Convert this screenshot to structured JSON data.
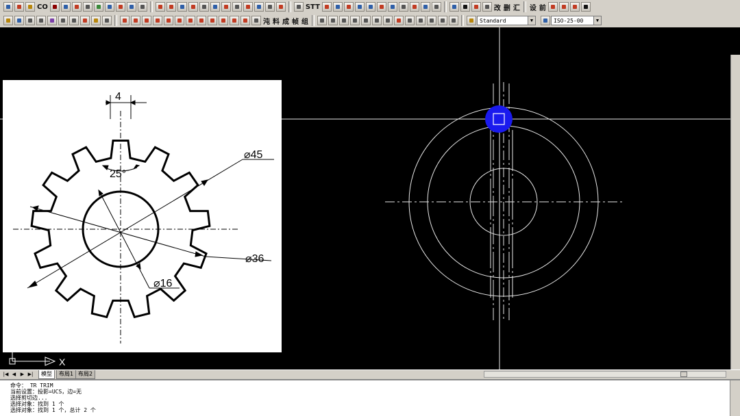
{
  "toolbar": {
    "standard_text_icons": [
      "CO",
      "STT"
    ],
    "chinese_row1": [
      "改",
      "删",
      "汇",
      "设",
      "前"
    ],
    "chinese_row2": [
      "沌",
      "料",
      "成",
      "帧",
      "组"
    ],
    "text_style": "Standard",
    "dim_style": "ISO-25-00"
  },
  "gear_drawing": {
    "dim_tooth_width": "4",
    "dim_tooth_angle": "25°",
    "dim_outer_diameter": "⌀45",
    "dim_root_diameter": "⌀36",
    "dim_bore_diameter": "⌀16"
  },
  "ucs": {
    "x_label": "X"
  },
  "layout_tabs": [
    "模型",
    "布局1",
    "布局2"
  ],
  "command_lines": [
    "命令： TR TRIM",
    "当前设置：投影=UCS，边=无",
    "选择剪切边...",
    "选择对象：找到 1 个",
    "选择对象：找到 1 个，总计 2 个"
  ],
  "colors": {
    "canvas": "#000000",
    "geometry": "#ffffff",
    "grip_highlight": "#1a1aee"
  }
}
